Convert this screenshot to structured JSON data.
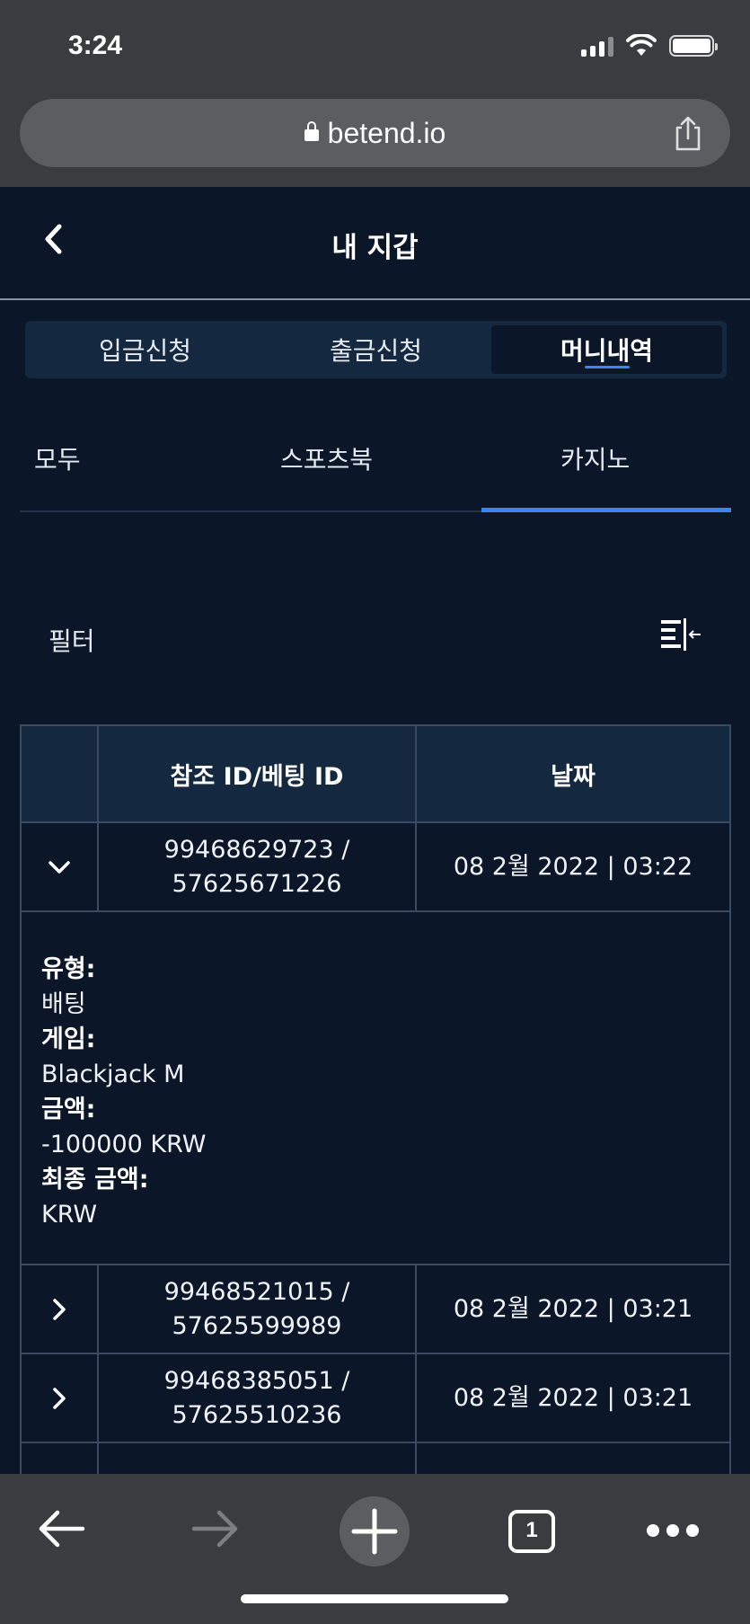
{
  "status_bar": {
    "time": "3:24"
  },
  "browser": {
    "url": "betend.io",
    "tab_count": "1"
  },
  "header": {
    "title": "내 지갑"
  },
  "segment_tabs": [
    {
      "label": "입금신청"
    },
    {
      "label": "출금신청"
    },
    {
      "label": "머니내역",
      "active": true
    }
  ],
  "sub_tabs": [
    {
      "label": "모두"
    },
    {
      "label": "스포츠북"
    },
    {
      "label": "카지노",
      "active": true
    }
  ],
  "filter": {
    "label": "필터"
  },
  "table": {
    "columns": [
      "",
      "참조 ID/베팅 ID",
      "날짜"
    ],
    "rows": [
      {
        "id_line1": "99468629723 /",
        "id_line2": "57625671226",
        "date": "08 2월 2022 | 03:22",
        "expanded": true
      },
      {
        "id_line1": "99468521015 /",
        "id_line2": "57625599989",
        "date": "08 2월 2022 | 03:21",
        "expanded": false
      },
      {
        "id_line1": "99468385051 /",
        "id_line2": "57625510236",
        "date": "08 2월 2022 | 03:21",
        "expanded": false
      }
    ],
    "detail": {
      "type_label": "유형:",
      "type_value": "배팅",
      "game_label": "게임:",
      "game_value": "Blackjack M",
      "amount_label": "금액:",
      "amount_value": "-100000 KRW",
      "final_label": "최종 금액:",
      "final_value": "KRW"
    }
  },
  "colors": {
    "background": "#0b1628",
    "panel": "#14283f",
    "accent": "#3a86f2",
    "browser_chrome": "#3b3c3f"
  }
}
